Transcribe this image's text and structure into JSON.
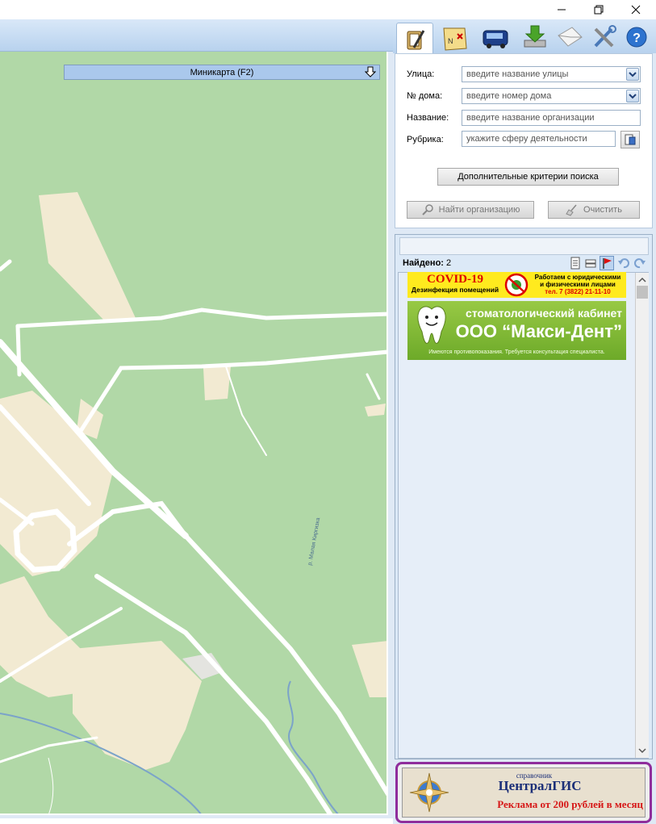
{
  "window": {
    "minimize": "—",
    "maximize": "❐",
    "close": "✕"
  },
  "map": {
    "minimap_label": "Миникарта (F2)",
    "river_label": "р. Малая Киргизка"
  },
  "tabs": [
    {
      "name": "search-tab",
      "icon": "clipboard-pencil-icon"
    },
    {
      "name": "map-tab",
      "icon": "treasure-map-icon"
    },
    {
      "name": "transport-tab",
      "icon": "bus-icon"
    },
    {
      "name": "download",
      "icon": "download-icon"
    },
    {
      "name": "mail",
      "icon": "envelope-icon"
    },
    {
      "name": "settings",
      "icon": "tools-icon"
    },
    {
      "name": "help",
      "icon": "help-icon"
    }
  ],
  "search": {
    "street_label": "Улица:",
    "street_placeholder": "введите название улицы",
    "house_label": "№ дома:",
    "house_placeholder": "введите номер дома",
    "name_label": "Название:",
    "name_placeholder": "введите название организации",
    "category_label": "Рубрика:",
    "category_placeholder": "укажите сферу деятельности",
    "advanced_button": "Дополнительные критерии поиска",
    "find_button": "Найти организацию",
    "clear_button": "Очистить"
  },
  "results": {
    "found_label": "Найдено:",
    "found_count": "2"
  },
  "ads": {
    "covid": {
      "title": "COVID-19",
      "subtitle": "Дезинфекция помещений",
      "line1": "Работаем с юридическими",
      "line2": "и физическими лицами",
      "phone": "тел. 7 (3822) 21-11-10"
    },
    "dental": {
      "kind": "стоматологический кабинет",
      "name": "ООО “Макси-Дент”",
      "disclaimer": "Имеются противопоказания. Требуется консультация специалиста."
    },
    "gis": {
      "small": "справочник",
      "brand": "ЦентралГИС",
      "offer": "Реклама от 200 рублей в месяц"
    }
  },
  "colors": {
    "map_green": "#b1d8a7",
    "map_road": "#ffffff",
    "map_urban": "#f2ead2",
    "river": "#7ba3c9",
    "banner_border": "#8f2d9c"
  }
}
